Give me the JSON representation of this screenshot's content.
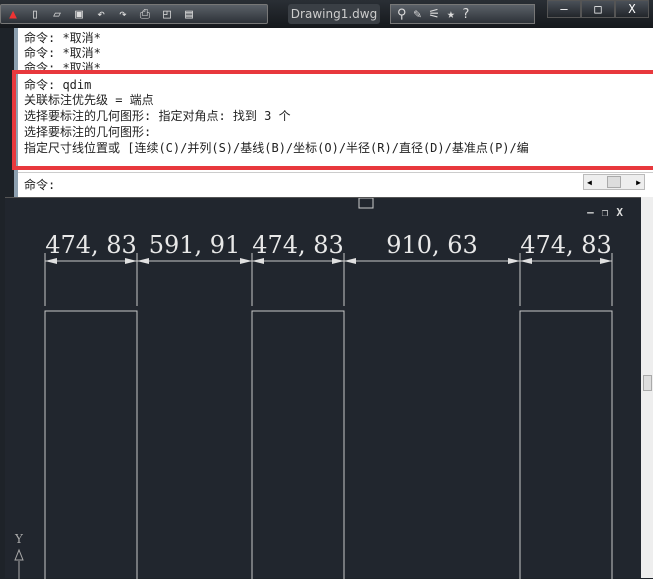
{
  "titlebar": {
    "doc_title": "Drawing1.dwg",
    "quick_access": [
      "app-menu-icon",
      "new-icon",
      "open-icon",
      "save-icon",
      "undo-icon",
      "redo-icon",
      "plot-icon",
      "preview-icon",
      "publish-icon"
    ],
    "tools": [
      "binoculars-icon",
      "wrench-icon",
      "satellite-icon",
      "star-icon",
      "help-icon"
    ],
    "window_buttons": [
      "–",
      "□",
      "X"
    ]
  },
  "command": {
    "history": [
      "命令: *取消*",
      "命令: *取消*",
      "命令: *取消*"
    ],
    "highlighted": [
      "命令: qdim",
      "关联标注优先级 = 端点",
      "选择要标注的几何图形: 指定对角点: 找到 3 个",
      "选择要标注的几何图形:",
      "指定尺寸线位置或 [连续(C)/并列(S)/基线(B)/坐标(O)/半径(R)/直径(D)/基准点(P)/编"
    ],
    "prompt": "命令:",
    "highlight_color": "#e8383d"
  },
  "viewport": {
    "controls": [
      "–",
      "❐",
      "X"
    ],
    "ucs_label": "Y",
    "dimensions": [
      "474, 83",
      "591, 91",
      "474, 83",
      "910, 63",
      "474, 83"
    ]
  }
}
